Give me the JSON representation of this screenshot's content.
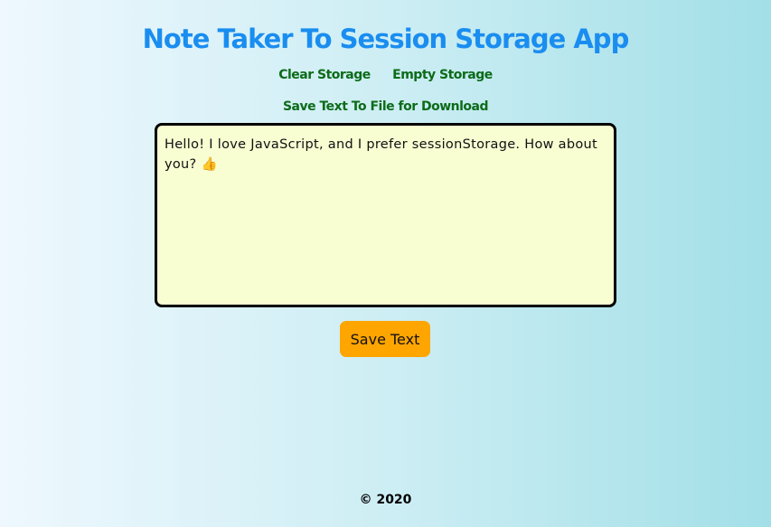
{
  "header": {
    "title": "Note Taker To Session Storage App"
  },
  "nav": {
    "clear_storage": "Clear Storage",
    "empty_storage": "Empty Storage",
    "save_to_file": "Save Text To File for Download"
  },
  "editor": {
    "value": "Hello! I love JavaScript, and I prefer sessionStorage. How about you? 👍"
  },
  "actions": {
    "save_label": "Save Text"
  },
  "footer": {
    "copyright": "© 2020"
  },
  "colors": {
    "title": "#1a8df0",
    "links": "#0c6b18",
    "editor_bg": "#f8fdd2",
    "button_bg": "#ffa500"
  }
}
